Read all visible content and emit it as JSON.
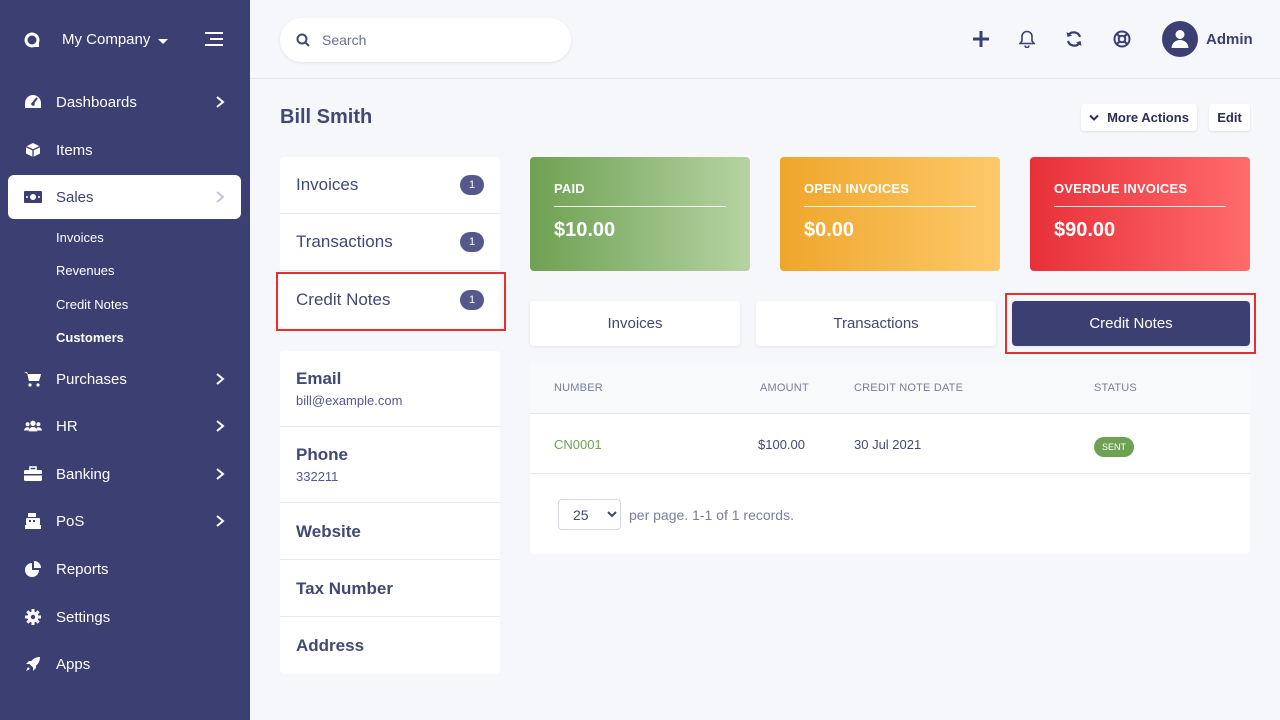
{
  "sidebar": {
    "company": "My Company",
    "items": [
      {
        "label": "Dashboards",
        "icon": "dashboard-icon"
      },
      {
        "label": "Items",
        "icon": "cube-icon"
      },
      {
        "label": "Sales",
        "icon": "money-bill-icon"
      },
      {
        "label": "Purchases",
        "icon": "cart-icon"
      },
      {
        "label": "HR",
        "icon": "users-icon"
      },
      {
        "label": "Banking",
        "icon": "briefcase-icon"
      },
      {
        "label": "PoS",
        "icon": "cash-register-icon"
      },
      {
        "label": "Reports",
        "icon": "pie-chart-icon"
      },
      {
        "label": "Settings",
        "icon": "gear-icon"
      },
      {
        "label": "Apps",
        "icon": "rocket-icon"
      }
    ],
    "sales_sub": [
      "Invoices",
      "Revenues",
      "Credit Notes",
      "Customers"
    ]
  },
  "header": {
    "search_placeholder": "Search",
    "user": "Admin"
  },
  "page": {
    "title": "Bill Smith",
    "more_actions": "More Actions",
    "edit": "Edit"
  },
  "summary": [
    {
      "label": "Invoices",
      "count": "1"
    },
    {
      "label": "Transactions",
      "count": "1"
    },
    {
      "label": "Credit Notes",
      "count": "1"
    }
  ],
  "contact": [
    {
      "label": "Email",
      "value": "bill@example.com"
    },
    {
      "label": "Phone",
      "value": "332211"
    },
    {
      "label": "Website",
      "value": ""
    },
    {
      "label": "Tax Number",
      "value": ""
    },
    {
      "label": "Address",
      "value": ""
    }
  ],
  "cards": [
    {
      "label": "PAID",
      "value": "$10.00",
      "color_from": "#6ea152",
      "color_to": "#b5d3a2"
    },
    {
      "label": "OPEN INVOICES",
      "value": "$0.00",
      "color_from": "#efa62b",
      "color_to": "#fdc96a"
    },
    {
      "label": "OVERDUE INVOICES",
      "value": "$90.00",
      "color_from": "#e8303a",
      "color_to": "#ff6b6b"
    }
  ],
  "tabs": [
    "Invoices",
    "Transactions",
    "Credit Notes"
  ],
  "table": {
    "headers": [
      "NUMBER",
      "AMOUNT",
      "CREDIT NOTE DATE",
      "STATUS"
    ],
    "rows": [
      {
        "number": "CN0001",
        "amount": "$100.00",
        "date": "30 Jul 2021",
        "status": "SENT"
      }
    ]
  },
  "pagination": {
    "per_page": "25",
    "text": "per page. 1-1 of 1 records."
  },
  "colors": {
    "sidebar": "#3c3f72",
    "accent": "#3c3f72",
    "highlight": "#e53030",
    "success": "#6ea152"
  }
}
